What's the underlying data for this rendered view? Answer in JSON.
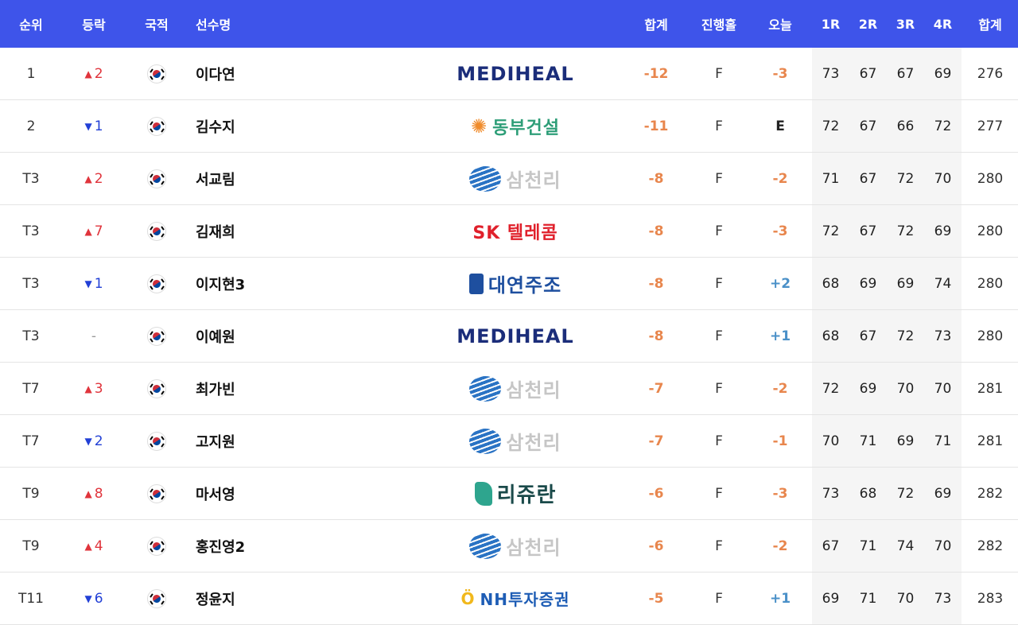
{
  "header": {
    "rank": "순위",
    "move": "등락",
    "nation": "국적",
    "name": "선수명",
    "total": "합계",
    "hole": "진행홀",
    "today": "오늘",
    "r1": "1R",
    "r2": "2R",
    "r3": "3R",
    "r4": "4R",
    "sum": "합계"
  },
  "colors": {
    "header_bg": "#3e54ea",
    "score_under": "#e8864d",
    "score_over": "#4a90c8",
    "move_up": "#e0343c",
    "move_down": "#2240d6"
  },
  "rows": [
    {
      "rank": "1",
      "dir": "up",
      "move": "2",
      "nation_icon": "korea-flag-icon",
      "name": "이다연",
      "sponsor": "MEDIHEAL",
      "sponsor_key": "mediheal",
      "total": "-12",
      "hole": "F",
      "today": "-3",
      "today_kind": "under",
      "r1": "73",
      "r2": "67",
      "r3": "67",
      "r4": "69",
      "sum": "276"
    },
    {
      "rank": "2",
      "dir": "down",
      "move": "1",
      "nation_icon": "korea-flag-icon",
      "name": "김수지",
      "sponsor": "동부건설",
      "sponsor_key": "dongbu",
      "total": "-11",
      "hole": "F",
      "today": "E",
      "today_kind": "even",
      "r1": "72",
      "r2": "67",
      "r3": "66",
      "r4": "72",
      "sum": "277"
    },
    {
      "rank": "T3",
      "dir": "up",
      "move": "2",
      "nation_icon": "korea-flag-icon",
      "name": "서교림",
      "sponsor": "삼천리",
      "sponsor_key": "samchully",
      "total": "-8",
      "hole": "F",
      "today": "-2",
      "today_kind": "under",
      "r1": "71",
      "r2": "67",
      "r3": "72",
      "r4": "70",
      "sum": "280"
    },
    {
      "rank": "T3",
      "dir": "up",
      "move": "7",
      "nation_icon": "korea-flag-icon",
      "name": "김재희",
      "sponsor": "SK 텔레콤",
      "sponsor_key": "sk",
      "total": "-8",
      "hole": "F",
      "today": "-3",
      "today_kind": "under",
      "r1": "72",
      "r2": "67",
      "r3": "72",
      "r4": "69",
      "sum": "280"
    },
    {
      "rank": "T3",
      "dir": "down",
      "move": "1",
      "nation_icon": "korea-flag-icon",
      "name": "이지현3",
      "sponsor": "대연주조",
      "sponsor_key": "daeyang",
      "total": "-8",
      "hole": "F",
      "today": "+2",
      "today_kind": "over",
      "r1": "68",
      "r2": "69",
      "r3": "69",
      "r4": "74",
      "sum": "280"
    },
    {
      "rank": "T3",
      "dir": "same",
      "move": "-",
      "nation_icon": "korea-flag-icon",
      "name": "이예원",
      "sponsor": "MEDIHEAL",
      "sponsor_key": "mediheal",
      "total": "-8",
      "hole": "F",
      "today": "+1",
      "today_kind": "over",
      "r1": "68",
      "r2": "67",
      "r3": "72",
      "r4": "73",
      "sum": "280"
    },
    {
      "rank": "T7",
      "dir": "up",
      "move": "3",
      "nation_icon": "korea-flag-icon",
      "name": "최가빈",
      "sponsor": "삼천리",
      "sponsor_key": "samchully",
      "total": "-7",
      "hole": "F",
      "today": "-2",
      "today_kind": "under",
      "r1": "72",
      "r2": "69",
      "r3": "70",
      "r4": "70",
      "sum": "281"
    },
    {
      "rank": "T7",
      "dir": "down",
      "move": "2",
      "nation_icon": "korea-flag-icon",
      "name": "고지원",
      "sponsor": "삼천리",
      "sponsor_key": "samchully",
      "total": "-7",
      "hole": "F",
      "today": "-1",
      "today_kind": "under",
      "r1": "70",
      "r2": "71",
      "r3": "69",
      "r4": "71",
      "sum": "281"
    },
    {
      "rank": "T9",
      "dir": "up",
      "move": "8",
      "nation_icon": "korea-flag-icon",
      "name": "마서영",
      "sponsor": "리쥬란",
      "sponsor_key": "lejuran",
      "total": "-6",
      "hole": "F",
      "today": "-3",
      "today_kind": "under",
      "r1": "73",
      "r2": "68",
      "r3": "72",
      "r4": "69",
      "sum": "282"
    },
    {
      "rank": "T9",
      "dir": "up",
      "move": "4",
      "nation_icon": "korea-flag-icon",
      "name": "홍진영2",
      "sponsor": "삼천리",
      "sponsor_key": "samchully",
      "total": "-6",
      "hole": "F",
      "today": "-2",
      "today_kind": "under",
      "r1": "67",
      "r2": "71",
      "r3": "74",
      "r4": "70",
      "sum": "282"
    },
    {
      "rank": "T11",
      "dir": "down",
      "move": "6",
      "nation_icon": "korea-flag-icon",
      "name": "정윤지",
      "sponsor": "NH투자증권",
      "sponsor_key": "nh",
      "total": "-5",
      "hole": "F",
      "today": "+1",
      "today_kind": "over",
      "r1": "69",
      "r2": "71",
      "r3": "70",
      "r4": "73",
      "sum": "283"
    }
  ]
}
